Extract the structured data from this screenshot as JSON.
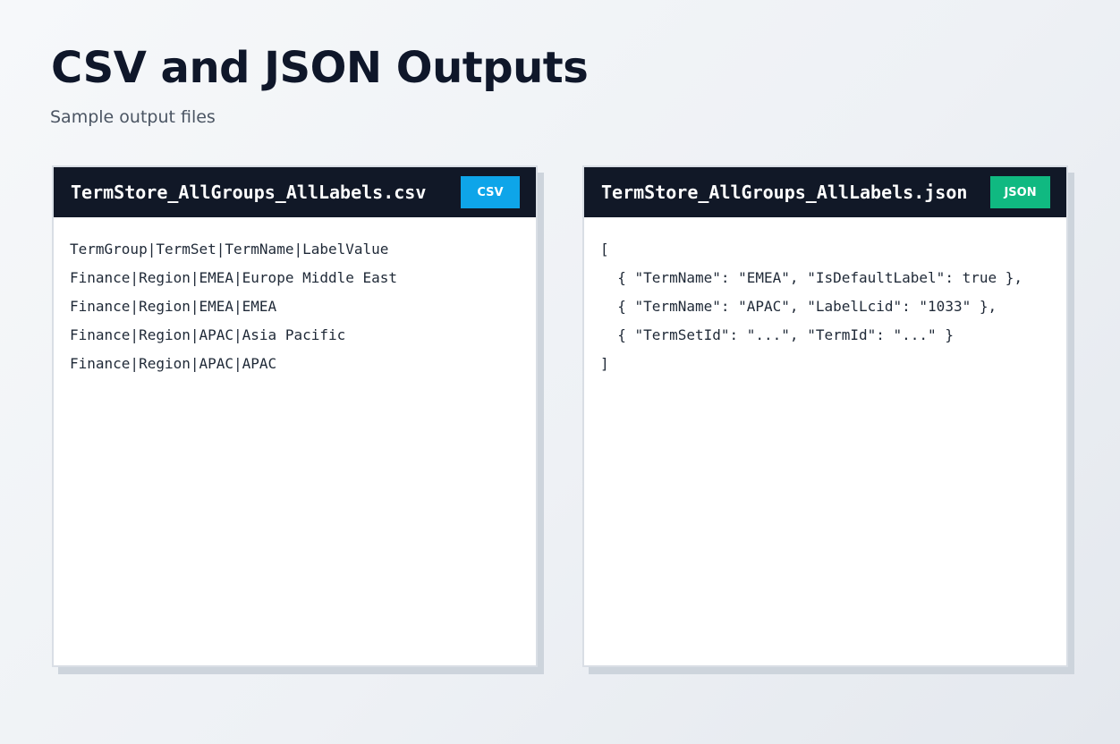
{
  "header": {
    "title": "CSV and JSON Outputs",
    "subtitle": "Sample output files"
  },
  "csv_panel": {
    "filename": "TermStore_AllGroups_AllLabels.csv",
    "badge": "CSV",
    "lines": [
      "TermGroup|TermSet|TermName|LabelValue",
      "Finance|Region|EMEA|Europe Middle East",
      "Finance|Region|EMEA|EMEA",
      "Finance|Region|APAC|Asia Pacific",
      "Finance|Region|APAC|APAC"
    ]
  },
  "json_panel": {
    "filename": "TermStore_AllGroups_AllLabels.json",
    "badge": "JSON",
    "lines": [
      "[",
      "  { \"TermName\": \"EMEA\", \"IsDefaultLabel\": true },",
      "  { \"TermName\": \"APAC\", \"LabelLcid\": \"1033\" },",
      "  { \"TermSetId\": \"...\", \"TermId\": \"...\" }",
      "]"
    ]
  },
  "colors": {
    "header_bg": "#111827",
    "csv_badge": "#0ea5e9",
    "json_badge": "#10b981",
    "title": "#0f172a"
  }
}
